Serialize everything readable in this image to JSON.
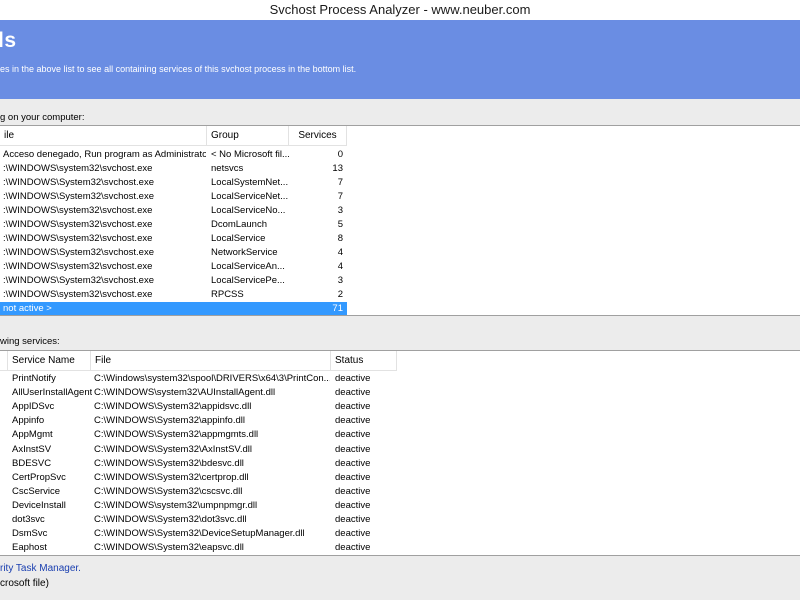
{
  "window": {
    "title": "Svchost Process Analyzer - www.neuber.com"
  },
  "header": {
    "heading": "ls",
    "description": "es in the above list to see all containing services of this svchost process in the bottom list."
  },
  "processes": {
    "section_label": "g on your computer:",
    "columns": {
      "file": "ile",
      "group": "Group",
      "services": "Services"
    },
    "rows": [
      {
        "file": "Acceso denegado, Run program as Administrato...",
        "group": "< No Microsoft fil...",
        "services": "0"
      },
      {
        "file": ":\\WINDOWS\\system32\\svchost.exe",
        "group": "netsvcs",
        "services": "13"
      },
      {
        "file": ":\\WINDOWS\\System32\\svchost.exe",
        "group": "LocalSystemNet...",
        "services": "7"
      },
      {
        "file": ":\\WINDOWS\\System32\\svchost.exe",
        "group": "LocalServiceNet...",
        "services": "7"
      },
      {
        "file": ":\\WINDOWS\\system32\\svchost.exe",
        "group": "LocalServiceNo...",
        "services": "3"
      },
      {
        "file": ":\\WINDOWS\\system32\\svchost.exe",
        "group": "DcomLaunch",
        "services": "5"
      },
      {
        "file": ":\\WINDOWS\\system32\\svchost.exe",
        "group": "LocalService",
        "services": "8"
      },
      {
        "file": ":\\WINDOWS\\System32\\svchost.exe",
        "group": "NetworkService",
        "services": "4"
      },
      {
        "file": ":\\WINDOWS\\system32\\svchost.exe",
        "group": "LocalServiceAn...",
        "services": "4"
      },
      {
        "file": ":\\WINDOWS\\System32\\svchost.exe",
        "group": "LocalServicePe...",
        "services": "3"
      },
      {
        "file": ":\\WINDOWS\\system32\\svchost.exe",
        "group": "RPCSS",
        "services": "2"
      },
      {
        "file": "not active >",
        "group": "",
        "services": "71",
        "selected": true
      }
    ]
  },
  "services": {
    "section_label": "wing services:",
    "columns": {
      "name": "Service Name",
      "file": "File",
      "status": "Status"
    },
    "rows": [
      {
        "name": "PrintNotify",
        "file": "C:\\Windows\\system32\\spool\\DRIVERS\\x64\\3\\PrintCon...",
        "status": "deactive"
      },
      {
        "name": "AllUserInstallAgent",
        "file": "C:\\WINDOWS\\system32\\AUInstallAgent.dll",
        "status": "deactive"
      },
      {
        "name": "AppIDSvc",
        "file": "C:\\WINDOWS\\System32\\appidsvc.dll",
        "status": "deactive"
      },
      {
        "name": "Appinfo",
        "file": "C:\\WINDOWS\\System32\\appinfo.dll",
        "status": "deactive"
      },
      {
        "name": "AppMgmt",
        "file": "C:\\WINDOWS\\System32\\appmgmts.dll",
        "status": "deactive"
      },
      {
        "name": "AxInstSV",
        "file": "C:\\WINDOWS\\System32\\AxInstSV.dll",
        "status": "deactive"
      },
      {
        "name": "BDESVC",
        "file": "C:\\WINDOWS\\System32\\bdesvc.dll",
        "status": "deactive"
      },
      {
        "name": "CertPropSvc",
        "file": "C:\\WINDOWS\\System32\\certprop.dll",
        "status": "deactive"
      },
      {
        "name": "CscService",
        "file": "C:\\WINDOWS\\System32\\cscsvc.dll",
        "status": "deactive"
      },
      {
        "name": "DeviceInstall",
        "file": "C:\\WINDOWS\\system32\\umpnpmgr.dll",
        "status": "deactive"
      },
      {
        "name": "dot3svc",
        "file": "C:\\WINDOWS\\System32\\dot3svc.dll",
        "status": "deactive"
      },
      {
        "name": "DsmSvc",
        "file": "C:\\WINDOWS\\System32\\DeviceSetupManager.dll",
        "status": "deactive"
      },
      {
        "name": "Eaphost",
        "file": "C:\\WINDOWS\\System32\\eapsvc.dll",
        "status": "deactive"
      }
    ]
  },
  "status_bar": {
    "link": "rity Task Manager.",
    "note": "crosoft file)"
  },
  "colors": {
    "header_bg": "#6a8de3",
    "selection": "#3399ff",
    "link": "#1a3fb0"
  }
}
